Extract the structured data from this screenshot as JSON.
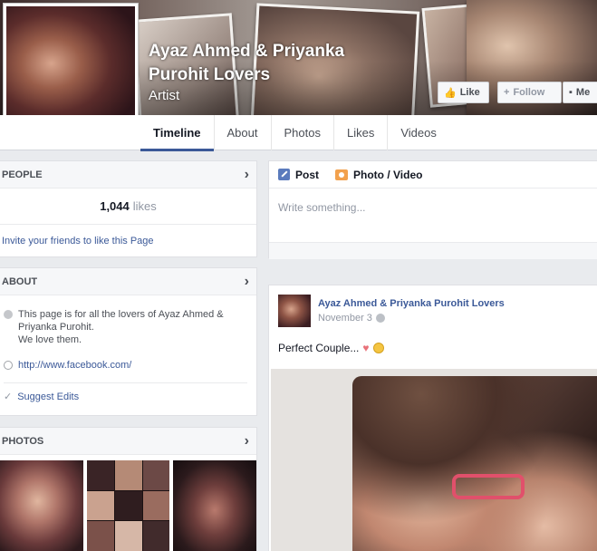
{
  "page": {
    "name": "Ayaz Ahmed & Priyanka Purohit Lovers",
    "category": "Artist"
  },
  "cover_buttons": {
    "like": "Like",
    "follow": "Follow",
    "message": "Me"
  },
  "nav": {
    "tabs": [
      {
        "label": "Timeline",
        "active": true
      },
      {
        "label": "About",
        "active": false
      },
      {
        "label": "Photos",
        "active": false
      },
      {
        "label": "Likes",
        "active": false
      },
      {
        "label": "Videos",
        "active": false
      }
    ]
  },
  "people": {
    "title": "PEOPLE",
    "likes_count": "1,044",
    "likes_label": "likes",
    "invite": "Invite your friends to like this Page"
  },
  "about": {
    "title": "ABOUT",
    "description": "This page is for all the lovers of Ayaz Ahmed & Priyanka Purohit.\nWe love them.",
    "url": "http://www.facebook.com/",
    "suggest_edits": "Suggest Edits"
  },
  "photos": {
    "title": "PHOTOS"
  },
  "composer": {
    "post_tab": "Post",
    "photo_tab": "Photo / Video",
    "placeholder": "Write something..."
  },
  "post": {
    "author": "Ayaz Ahmed & Priyanka Purohit Lovers",
    "date": "November 3",
    "text": "Perfect Couple..."
  },
  "icons": {
    "heart": "heart-icon",
    "smile": "smile-icon",
    "globe": "globe-icon",
    "chevron": "chevron-right-icon",
    "like": "thumbs-up-icon",
    "follow": "plus-icon",
    "message": "message-icon"
  },
  "colors": {
    "link": "#3b5998",
    "active_tab_underline": "#3b5998",
    "heart": "#e8727a"
  }
}
